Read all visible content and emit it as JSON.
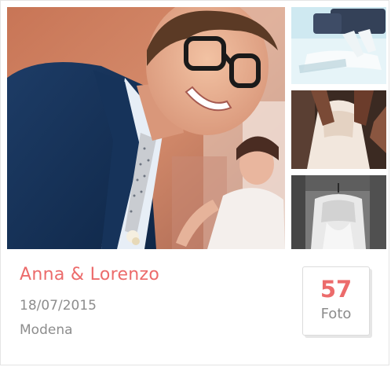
{
  "event": {
    "title": "Anna & Lorenzo",
    "date": "18/07/2015",
    "place": "Modena"
  },
  "photos": {
    "count": "57",
    "count_label": "Foto"
  },
  "colors": {
    "accent": "#ec6b6b",
    "muted_text": "#8d8d8d",
    "border": "#e4e4e4"
  }
}
